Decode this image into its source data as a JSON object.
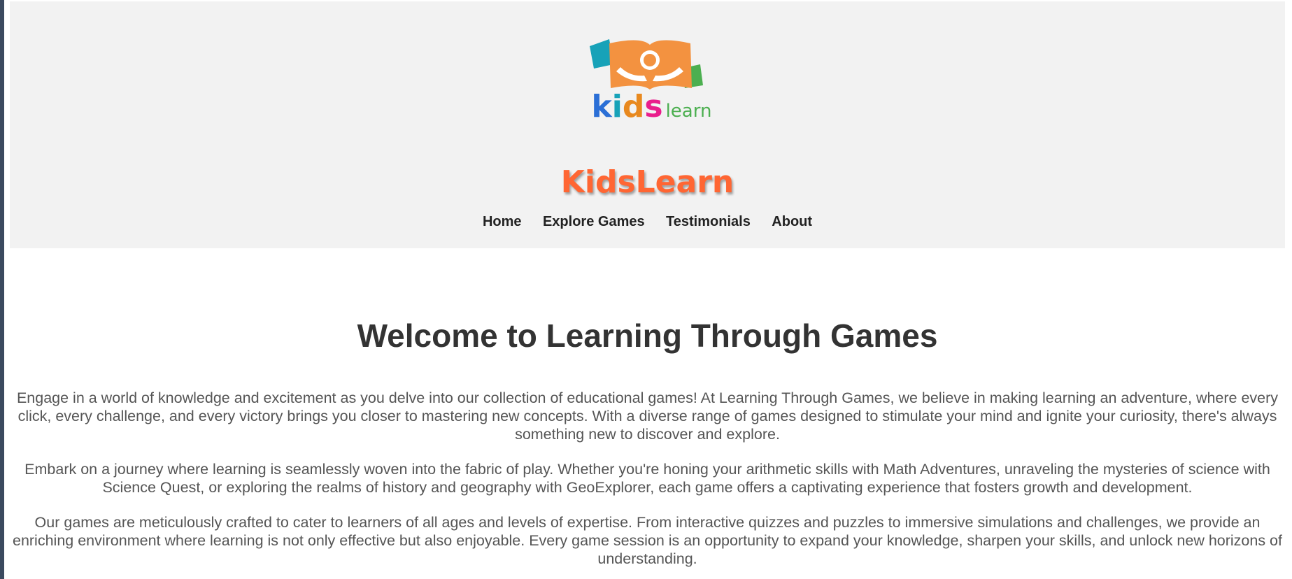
{
  "header": {
    "logo": {
      "word_letters": [
        "k",
        "i",
        "d",
        "s"
      ],
      "word_suffix": "learn",
      "colors": {
        "book": "#f39240",
        "page_left": "#17a2b8",
        "page_right": "#4caf50",
        "k": "#2b6fd6",
        "i": "#17a2b8",
        "d": "#e8891f",
        "s": "#e91e8c",
        "learn": "#4caf50"
      }
    },
    "brand_title": "KidsLearn",
    "nav": [
      {
        "label": "Home"
      },
      {
        "label": "Explore Games"
      },
      {
        "label": "Testimonials"
      },
      {
        "label": "About"
      }
    ]
  },
  "main": {
    "heading": "Welcome to Learning Through Games",
    "paragraphs": [
      "Engage in a world of knowledge and excitement as you delve into our collection of educational games! At Learning Through Games, we believe in making learning an adventure, where every click, every challenge, and every victory brings you closer to mastering new concepts. With a diverse range of games designed to stimulate your mind and ignite your curiosity, there's always something new to discover and explore.",
      "Embark on a journey where learning is seamlessly woven into the fabric of play. Whether you're honing your arithmetic skills with Math Adventures, unraveling the mysteries of science with Science Quest, or exploring the realms of history and geography with GeoExplorer, each game offers a captivating experience that fosters growth and development.",
      "Our games are meticulously crafted to cater to learners of all ages and levels of expertise. From interactive quizzes and puzzles to immersive simulations and challenges, we provide an enriching environment where learning is not only effective but also enjoyable. Every game session is an opportunity to expand your knowledge, sharpen your skills, and unlock new horizons of understanding."
    ]
  },
  "colors": {
    "header_bg": "#f2f2f2",
    "brand": "#ff6633",
    "nav_text": "#222222",
    "heading": "#333333",
    "body_text": "#555555",
    "left_rail": "#3b4a5f"
  }
}
